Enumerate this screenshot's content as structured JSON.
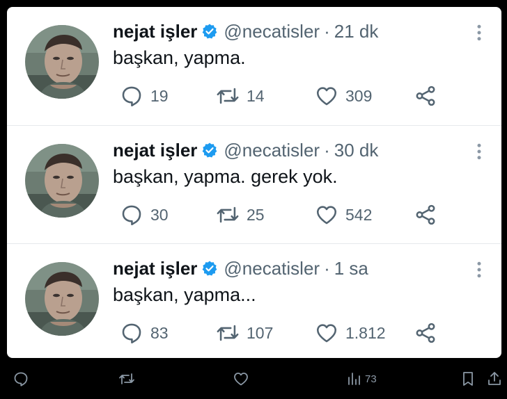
{
  "tweets": [
    {
      "name": "nejat işler",
      "handle": "@necatisler",
      "sep": "·",
      "time": "21 dk",
      "text": "başkan, yapma.",
      "replies": "19",
      "retweets": "14",
      "likes": "309"
    },
    {
      "name": "nejat işler",
      "handle": "@necatisler",
      "sep": "·",
      "time": "30 dk",
      "text": "başkan, yapma. gerek yok.",
      "replies": "30",
      "retweets": "25",
      "likes": "542"
    },
    {
      "name": "nejat işler",
      "handle": "@necatisler",
      "sep": "·",
      "time": "1 sa",
      "text": "başkan, yapma...",
      "replies": "83",
      "retweets": "107",
      "likes": "1.812"
    }
  ],
  "bottom_bar": {
    "views": "73"
  },
  "icons": {
    "verified": "verified-badge-icon",
    "reply": "reply-icon",
    "retweet": "retweet-icon",
    "like": "heart-icon",
    "share": "share-icon",
    "more": "more-vertical-icon",
    "views": "views-icon",
    "bookmark": "bookmark-icon",
    "upload": "upload-icon"
  },
  "colors": {
    "verified": "#1d9bf0",
    "secondary_text": "#536471",
    "primary_text": "#0f1419",
    "background": "#000000",
    "card": "#ffffff"
  }
}
